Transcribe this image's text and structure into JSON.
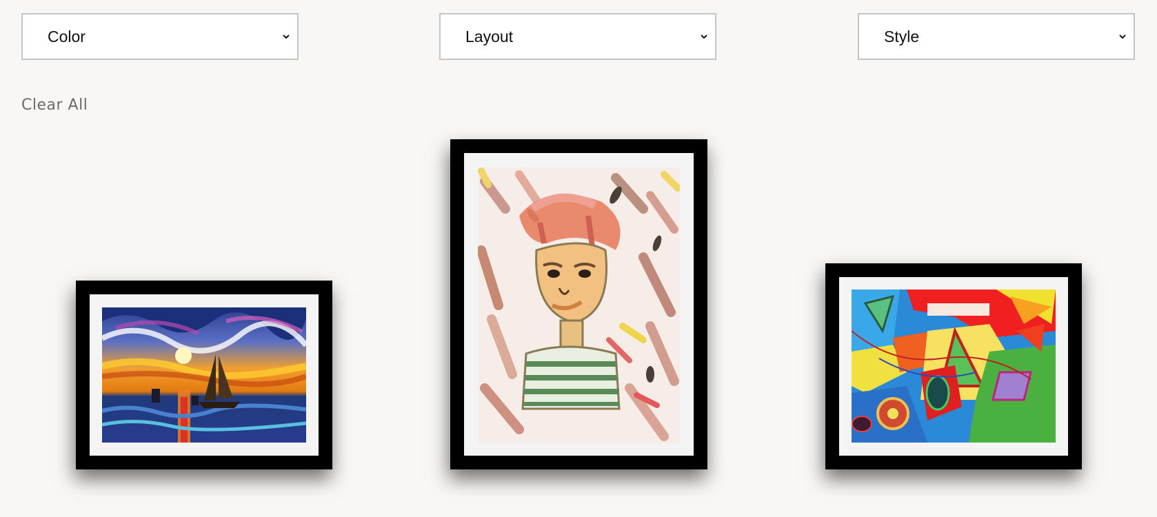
{
  "filters": {
    "color": {
      "label": "Color",
      "icon": "chevron-down-icon"
    },
    "layout": {
      "label": "Layout",
      "icon": "chevron-down-icon"
    },
    "style": {
      "label": "Style",
      "icon": "chevron-down-icon"
    }
  },
  "clear_all_label": "Clear All",
  "artworks": [
    {
      "subject": "sailboat-sunset-painting",
      "frame_color": "#000000",
      "mat_color": "#f4f4f4"
    },
    {
      "subject": "child-portrait-painting",
      "frame_color": "#000000",
      "mat_color": "#f4f4f4"
    },
    {
      "subject": "abstract-colorful-painting",
      "frame_color": "#000000",
      "mat_color": "#f4f4f4"
    }
  ],
  "colors": {
    "background": "#f8f7f5",
    "select_border": "#c4c4c4",
    "clear_all_text": "#6b6b6b"
  }
}
